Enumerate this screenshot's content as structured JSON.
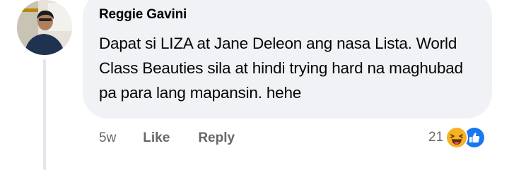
{
  "comment": {
    "author": "Reggie Gavini",
    "text": "Dapat si LIZA at Jane Deleon ang nasa Lista. World Class Beauties sila at hindi trying hard na maghubad pa para lang mapansin. hehe",
    "time": "5w",
    "like_label": "Like",
    "reply_label": "Reply",
    "reaction_count": "21",
    "reactions": [
      "haha-icon",
      "like-icon"
    ]
  },
  "colors": {
    "bubble": "#f0f2f5",
    "secondary_text": "#65676b",
    "like_blue": "#1877f2",
    "haha_yellow": "#f7b125"
  }
}
